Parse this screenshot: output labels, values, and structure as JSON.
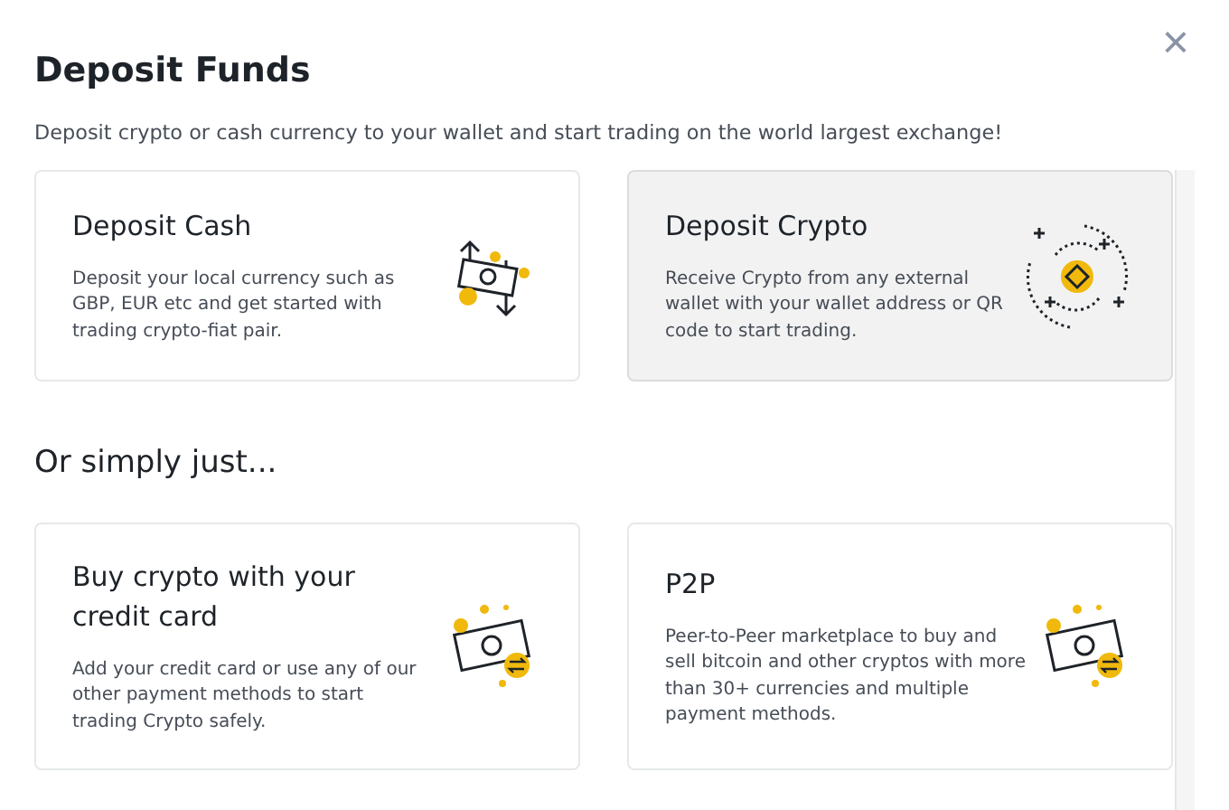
{
  "dialog": {
    "title": "Deposit Funds",
    "subtitle": "Deposit crypto or cash currency to your wallet and start trading on the world largest exchange!",
    "close": "×"
  },
  "sections": [
    {
      "cards": [
        {
          "title": "Deposit Cash",
          "description": "Deposit your local currency such as GBP, EUR etc and get started with trading crypto-fiat pair.",
          "kind": "exchange",
          "selected": false
        },
        {
          "title": "Deposit Crypto",
          "description": "Receive Crypto from any external wallet with your wallet address or QR code to start trading.",
          "kind": "coin",
          "selected": true
        }
      ]
    },
    {
      "heading": "Or simply just...",
      "cards": [
        {
          "title": "Buy crypto with your credit card",
          "description": "Add your credit card or use any of our other payment methods to start trading Crypto safely.",
          "kind": "bill",
          "selected": false
        },
        {
          "title": "P2P",
          "description": "Peer-to-Peer marketplace to buy and sell bitcoin and other cryptos with more than 30+ currencies and multiple payment methods.",
          "kind": "bill",
          "selected": false
        }
      ]
    }
  ]
}
